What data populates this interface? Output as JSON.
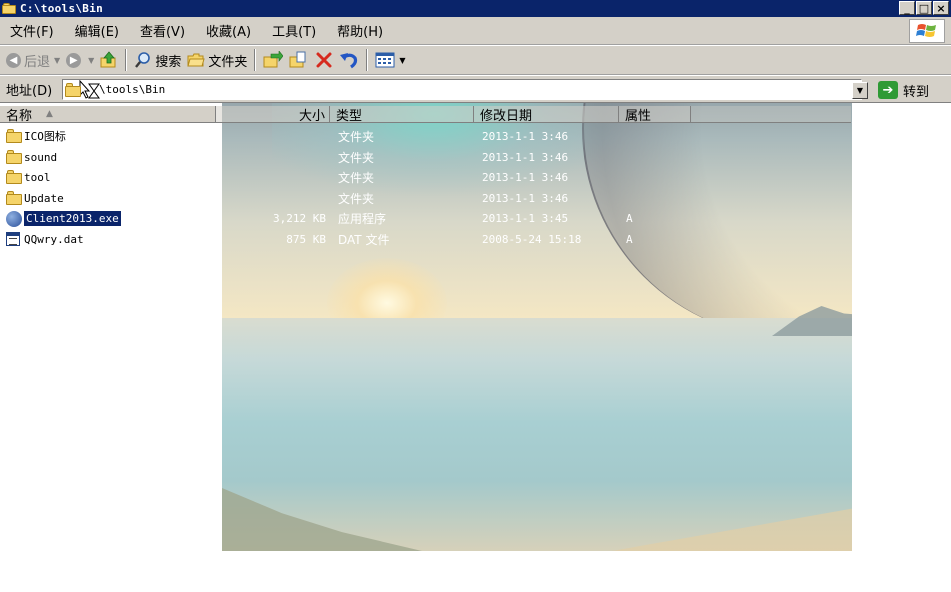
{
  "window": {
    "title": "C:\\tools\\Bin",
    "min_glyph": "_",
    "max_glyph": "□",
    "close_glyph": "×"
  },
  "menu": {
    "items": [
      "文件(F)",
      "编辑(E)",
      "查看(V)",
      "收藏(A)",
      "工具(T)",
      "帮助(H)"
    ]
  },
  "toolbar": {
    "back_label": "后退",
    "search_label": "搜索",
    "folders_label": "文件夹"
  },
  "address": {
    "label": "地址(D)",
    "path": "\\tools\\Bin",
    "go_label": "转到"
  },
  "columns": {
    "name": "名称",
    "size": "大小",
    "type": "类型",
    "modified": "修改日期",
    "attributes": "属性"
  },
  "files": [
    {
      "name": "ICO图标",
      "size": "",
      "type": "文件夹",
      "modified": "2013-1-1 3:46",
      "attr": "",
      "icon": "folder-icon"
    },
    {
      "name": "sound",
      "size": "",
      "type": "文件夹",
      "modified": "2013-1-1 3:46",
      "attr": "",
      "icon": "folder-icon"
    },
    {
      "name": "tool",
      "size": "",
      "type": "文件夹",
      "modified": "2013-1-1 3:46",
      "attr": "",
      "icon": "folder-icon"
    },
    {
      "name": "Update",
      "size": "",
      "type": "文件夹",
      "modified": "2013-1-1 3:46",
      "attr": "",
      "icon": "folder-icon"
    },
    {
      "name": "Client2013.exe",
      "size": "3,212 KB",
      "type": "应用程序",
      "modified": "2013-1-1 3:45",
      "attr": "A",
      "icon": "app-icon",
      "selected": true
    },
    {
      "name": "QQwry.dat",
      "size": "875 KB",
      "type": "DAT 文件",
      "modified": "2008-5-24 15:18",
      "attr": "A",
      "icon": "dat-file-icon"
    }
  ],
  "colors": {
    "titlebar": "#0a246a",
    "chrome": "#d4d0c8",
    "selection": "#0a246a"
  }
}
